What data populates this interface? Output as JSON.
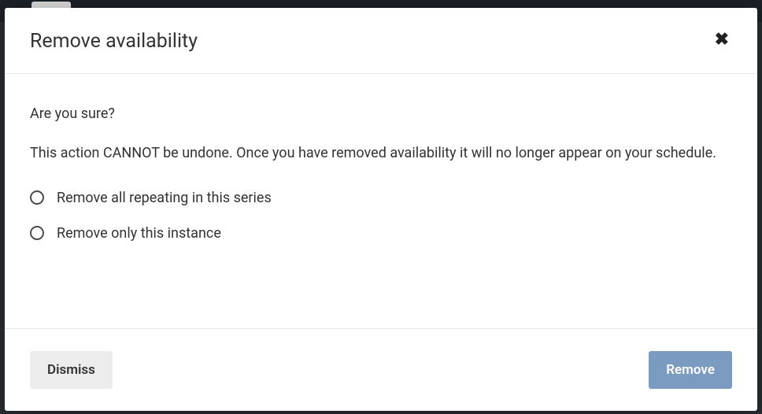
{
  "modal": {
    "title": "Remove availability",
    "confirm_question": "Are you sure?",
    "warning": "This action CANNOT be undone. Once you have removed availability it will no longer appear on your schedule.",
    "options": [
      {
        "label": "Remove all repeating in this series"
      },
      {
        "label": "Remove only this instance"
      }
    ],
    "dismiss_label": "Dismiss",
    "remove_label": "Remove"
  }
}
